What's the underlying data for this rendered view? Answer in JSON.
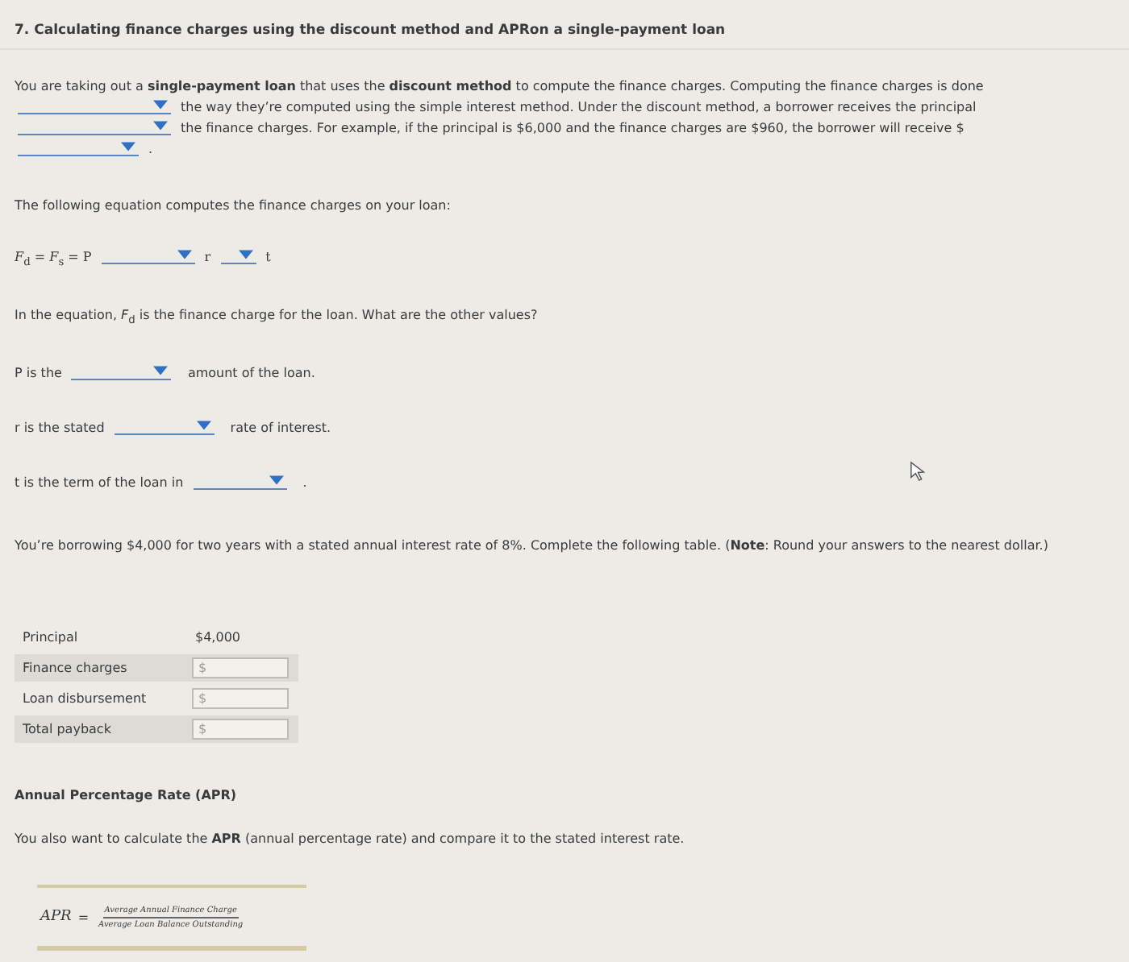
{
  "title": "7. Calculating finance charges using the discount method and APRon a single-payment loan",
  "intro": [
    {
      "kind": "text",
      "text": "You are taking out a **single-payment loan** that uses the **discount method** to compute the finance charges. Computing the finance charges is done"
    },
    {
      "kind": "dropdown"
    },
    {
      "kind": "text",
      "text": "the way they’re computed using the simple interest method. Under the discount method, a borrower receives the principal"
    },
    {
      "kind": "dropdown"
    },
    {
      "kind": "text",
      "text": "the finance charges. For example, if the principal is $6,000 and the finance charges are $960, the borrower will receive $"
    },
    {
      "kind": "dropdown"
    },
    {
      "kind": "text",
      "text": "."
    }
  ],
  "equation_intro": "The following equation computes the finance charges on your loan:",
  "equation": [
    {
      "kind": "text",
      "text": "*F*$_{d}$ = *F*$_{s}$ = P"
    },
    {
      "kind": "dropdown"
    },
    {
      "kind": "text",
      "text": "r"
    },
    {
      "kind": "dropdown"
    },
    {
      "kind": "text",
      "text": "t"
    }
  ],
  "question": "In the equation, *F*$_{d}$ is the finance charge for the loan. What are the other values?",
  "definitions": [
    {
      "before": "P is the",
      "after": "amount of the loan."
    },
    {
      "before": "r is the stated",
      "after": "rate of interest."
    },
    {
      "before": "t is the term of the loan in",
      "after": "."
    }
  ],
  "problem": "You’re borrowing $4,000 for two years with a stated annual interest rate of 8%. Complete the following table. (**Note**: Round your answers to the nearest dollar.)",
  "table": [
    {
      "kind": "value",
      "label": "Principal",
      "value": "$4,000"
    },
    {
      "kind": "input",
      "label": "Finance charges",
      "prefix": "$"
    },
    {
      "kind": "input",
      "label": "Loan disbursement",
      "prefix": "$"
    },
    {
      "kind": "input",
      "label": "Total payback",
      "prefix": "$"
    }
  ],
  "apr_heading": "Annual Percentage Rate (APR)",
  "apr_text": "You also want to calculate the **APR** (annual percentage rate) and compare it to the stated interest rate.",
  "formula": {
    "lhs": "APR",
    "eq": "=",
    "numerator": "Average Annual Finance Charge",
    "denominator": "Average Loan Balance Outstanding"
  }
}
